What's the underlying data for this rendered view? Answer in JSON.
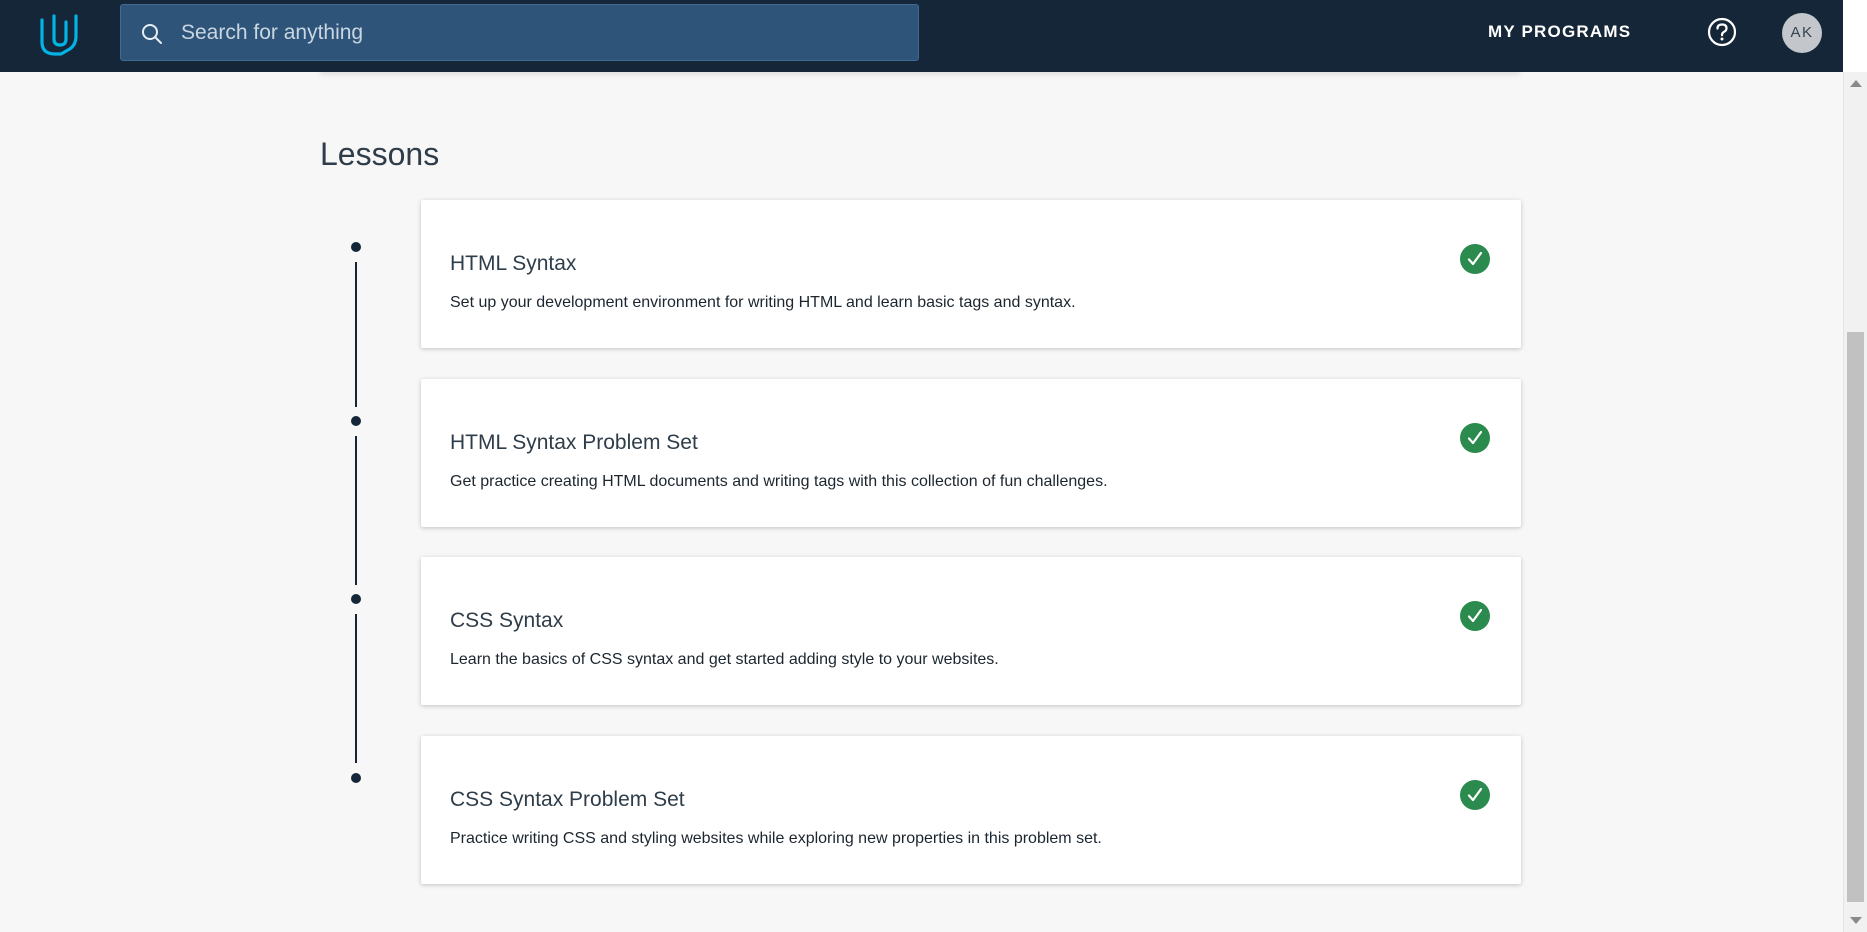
{
  "header": {
    "logo_icon": "udacity-logo-icon",
    "search": {
      "placeholder": "Search for anything",
      "value": ""
    },
    "nav_programs_label": "MY PROGRAMS",
    "help_icon": "question-circle-icon",
    "avatar_initials": "AK"
  },
  "lessons": {
    "heading": "Lessons",
    "items": [
      {
        "title": "HTML Syntax",
        "description": "Set up your development environment for writing HTML and learn basic tags and syntax.",
        "status_icon": "check-circle-icon",
        "completed": true
      },
      {
        "title": "HTML Syntax Problem Set",
        "description": "Get practice creating HTML documents and writing tags with this collection of fun challenges.",
        "status_icon": "check-circle-icon",
        "completed": true
      },
      {
        "title": "CSS Syntax",
        "description": "Learn the basics of CSS syntax and get started adding style to your websites.",
        "status_icon": "check-circle-icon",
        "completed": true
      },
      {
        "title": "CSS Syntax Problem Set",
        "description": "Practice writing CSS and styling websites while exploring new properties in this problem set.",
        "status_icon": "check-circle-icon",
        "completed": true
      }
    ]
  },
  "colors": {
    "nav_background": "#142638",
    "search_background": "#2e5479",
    "logo_accent": "#02b3e4",
    "completed_green": "#2b8a4e",
    "page_background": "#f7f7f7"
  }
}
